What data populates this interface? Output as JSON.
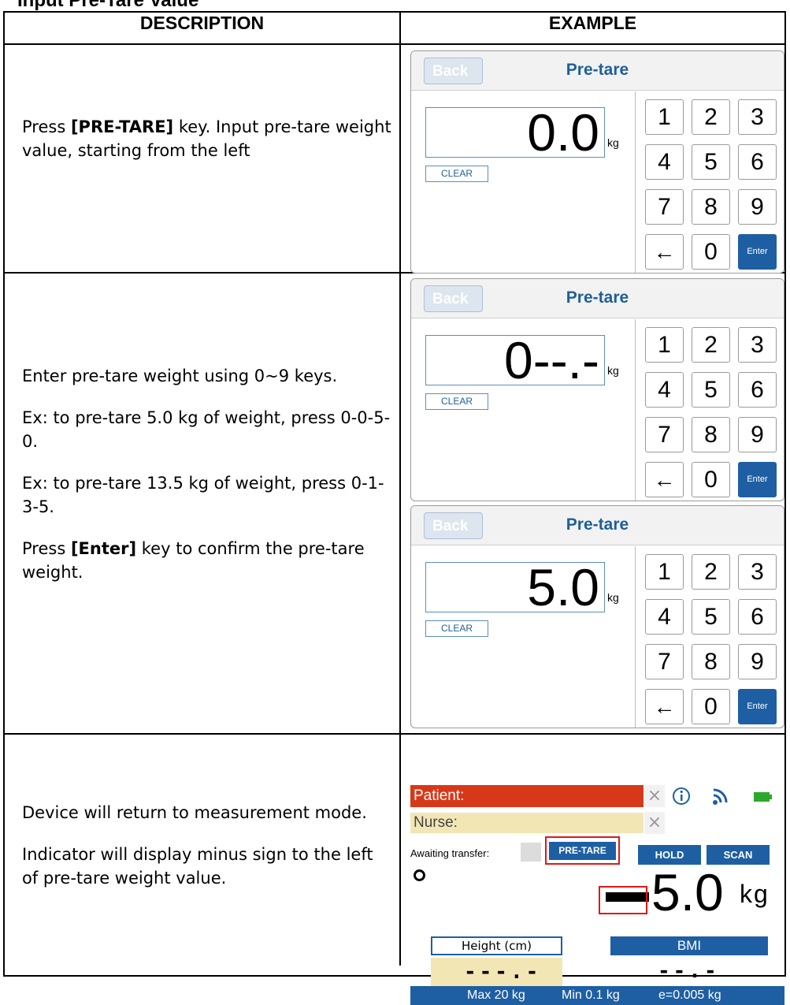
{
  "heading": "Input Pre-Tare Value",
  "columns": {
    "description": "DESCRIPTION",
    "example": "EXAMPLE"
  },
  "rows": [
    {
      "paragraphs": [
        {
          "pre": "Press ",
          "bold": "[PRE-TARE]",
          "post": " key. Input pre-tare weight value, starting from the left"
        }
      ]
    },
    {
      "paragraphs": [
        {
          "pre": "Enter pre-tare weight using 0~9 keys.",
          "bold": "",
          "post": ""
        },
        {
          "pre": "Ex: to pre-tare 5.0 kg of weight, press 0-0-5-0.",
          "bold": "",
          "post": ""
        },
        {
          "pre": "Ex: to pre-tare 13.5 kg of weight, press 0-1-3-5.",
          "bold": "",
          "post": ""
        },
        {
          "pre": "Press ",
          "bold": "[Enter]",
          "post": " key to confirm the pre-tare weight."
        }
      ]
    },
    {
      "paragraphs": [
        {
          "pre": "Device will return to measurement mode.",
          "bold": "",
          "post": ""
        },
        {
          "pre": "Indicator will display minus sign to the left of pre-tare weight value.",
          "bold": "",
          "post": ""
        }
      ]
    }
  ],
  "panels": [
    {
      "back": "Back",
      "title": "Pre-tare",
      "display": "0.0",
      "unit": "kg",
      "clear": "CLEAR"
    },
    {
      "back": "Back",
      "title": "Pre-tare",
      "display": "0--.-",
      "unit": "kg",
      "clear": "CLEAR"
    },
    {
      "back": "Back",
      "title": "Pre-tare",
      "display": "5.0",
      "unit": "kg",
      "clear": "CLEAR"
    }
  ],
  "keypad": [
    "1",
    "2",
    "3",
    "4",
    "5",
    "6",
    "7",
    "8",
    "9",
    "←",
    "0",
    "Enter"
  ],
  "measurement": {
    "patient_label": "Patient:",
    "nurse_label": "Nurse:",
    "close_glyph": "×",
    "awaiting_label": "Awaiting transfer:",
    "pretare_button": "PRE-TARE",
    "hold_button": "HOLD",
    "scan_button": "SCAN",
    "weight": "5.0",
    "weight_unit": "kg",
    "height_label": "Height (cm)",
    "height_value": "---.-",
    "bmi_label": "BMI",
    "bmi_value": "--.-",
    "footer_max": "Max 20 kg",
    "footer_min": "Min 0.1 kg",
    "footer_e": "e=0.005 kg",
    "colors": {
      "patient": "#d8381a",
      "nurse": "#f3e6b5",
      "accent": "#1e5fa3",
      "highlight": "#e01818",
      "battery": "#2ca82c"
    }
  }
}
